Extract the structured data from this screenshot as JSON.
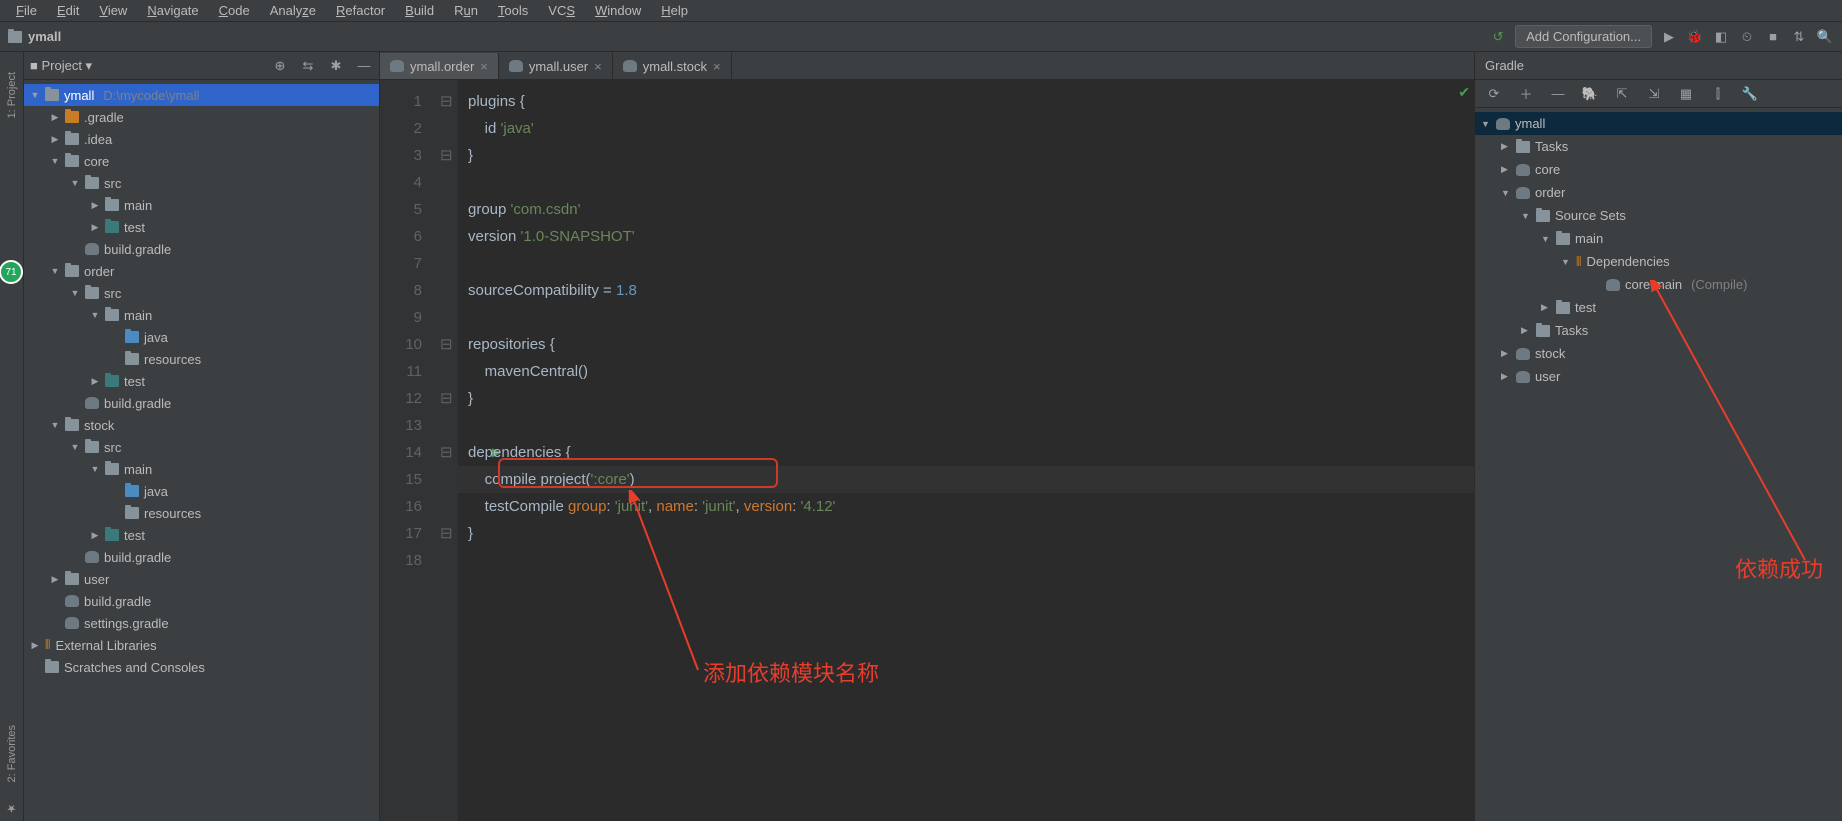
{
  "menu": {
    "file": "File",
    "edit": "Edit",
    "view": "View",
    "navigate": "Navigate",
    "code": "Code",
    "analyze": "Analyze",
    "refactor": "Refactor",
    "build": "Build",
    "run": "Run",
    "tools": "Tools",
    "vcs": "VCS",
    "window": "Window",
    "help": "Help"
  },
  "breadcrumb": {
    "root": "ymall"
  },
  "toolbar": {
    "add_config": "Add Configuration..."
  },
  "project": {
    "header": "Project",
    "root": "ymall",
    "root_path": "D:\\mycode\\ymall",
    "items": {
      "gradle": ".gradle",
      "idea": ".idea",
      "core": "core",
      "src": "src",
      "main": "main",
      "test": "test",
      "build_gradle": "build.gradle",
      "order": "order",
      "java": "java",
      "resources": "resources",
      "stock": "stock",
      "user": "user",
      "settings_gradle": "settings.gradle",
      "external_libs": "External Libraries",
      "scratches": "Scratches and Consoles"
    }
  },
  "tabs": {
    "t1": "ymall.order",
    "t2": "ymall.user",
    "t3": "ymall.stock"
  },
  "code": {
    "l1a": "plugins {",
    "l2": "    id ",
    "l2s": "'java'",
    "l3": "}",
    "l5a": "group ",
    "l5s": "'com.csdn'",
    "l6a": "version ",
    "l6s": "'1.0-SNAPSHOT'",
    "l8a": "sourceCompatibility = ",
    "l8n": "1.8",
    "l10": "repositories {",
    "l11": "    mavenCentral()",
    "l12": "}",
    "l14": "dependencies {",
    "l15a": "    compile project",
    "l15b": "(",
    "l15s": "':core'",
    "l15c": ")",
    "l16a": "    testCompile ",
    "l16k1": "group",
    "l16c1": ": ",
    "l16s1": "'junit'",
    "l16c2": ", ",
    "l16k2": "name",
    "l16c3": ": ",
    "l16s2": "'junit'",
    "l16c4": ", ",
    "l16k3": "version",
    "l16c5": ": ",
    "l16s3": "'4.12'",
    "l17": "}"
  },
  "gradle": {
    "title": "Gradle",
    "root": "ymall",
    "tasks": "Tasks",
    "core": "core",
    "order": "order",
    "source_sets": "Source Sets",
    "main": "main",
    "deps": "Dependencies",
    "core_main": "core:main",
    "compile": "(Compile)",
    "test": "test",
    "stock": "stock",
    "user": "user"
  },
  "annotations": {
    "left": "添加依赖模块名称",
    "right": "依赖成功"
  },
  "sidebar": {
    "project": "1: Project",
    "favorites": "2: Favorites"
  },
  "badge": "71"
}
